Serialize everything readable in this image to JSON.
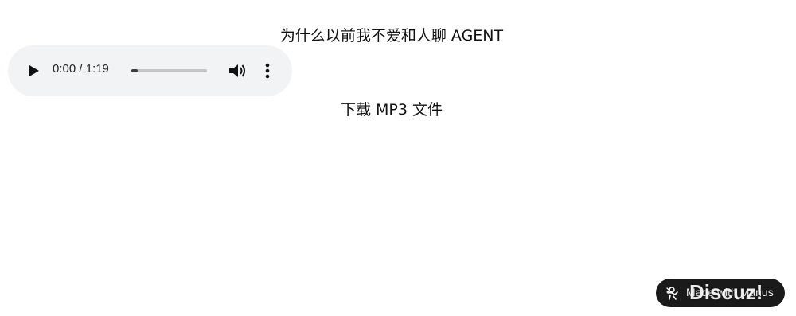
{
  "page": {
    "title": "为什么以前我不爱和人聊 AGENT",
    "download_label": "下载 MP3 文件"
  },
  "player": {
    "play_icon": "play-icon",
    "time_display": "0:00 / 1:19",
    "progress_fraction": 0.08,
    "volume_icon": "volume-icon",
    "more_icon": "more-vert-icon",
    "background_color": "#f1f3f4"
  },
  "badge": {
    "label": "Made with Manus",
    "icon": "manus-logo-icon",
    "background_color": "#1a1a1a"
  },
  "watermark": {
    "text": "Discuz!"
  }
}
